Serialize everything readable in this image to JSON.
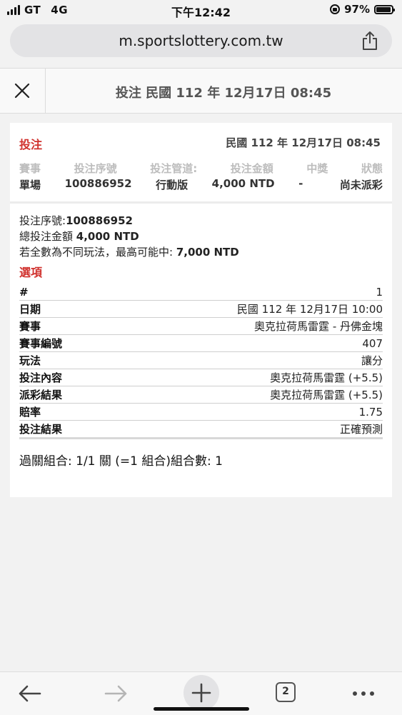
{
  "status_bar": {
    "carrier": "GT",
    "network": "4G",
    "time": "下午12:42",
    "battery": "97%"
  },
  "browser": {
    "url": "m.sportslottery.com.tw",
    "tab_count": "2"
  },
  "header": {
    "title": "投注 民國 112 年 12月17日 08:45"
  },
  "summary": {
    "title": "投注",
    "date": "民國 112 年 12月17日 08:45",
    "columns": [
      "賽事",
      "投注序號",
      "投注管道:",
      "投注金額",
      "中獎",
      "狀態"
    ],
    "values": [
      "單場",
      "100886952",
      "行動版",
      "4,000 NTD",
      "-",
      "尚未派彩"
    ]
  },
  "detail": {
    "serial_label": "投注序號:",
    "serial_value": "100886952",
    "total_label": "總投注金額 ",
    "total_value": "4,000 NTD",
    "max_win_label": "若全數為不同玩法，最高可能中: ",
    "max_win_value": "7,000 NTD"
  },
  "options": {
    "title": "選項",
    "rows": [
      {
        "label": "#",
        "value": "1"
      },
      {
        "label": "日期",
        "value": "民國 112 年 12月17日 10:00"
      },
      {
        "label": "賽事",
        "value": "奧克拉荷馬雷霆 - 丹佛金塊"
      },
      {
        "label": "賽事編號",
        "value": "407"
      },
      {
        "label": "玩法",
        "value": "讓分"
      },
      {
        "label": "投注內容",
        "value": "奧克拉荷馬雷霆 (+5.5)"
      },
      {
        "label": "派彩結果",
        "value": "奧克拉荷馬雷霆 (+5.5)"
      },
      {
        "label": "賠率",
        "value": "1.75"
      },
      {
        "label": "投注結果",
        "value": "正確預測"
      }
    ]
  },
  "combo": {
    "text": "過關組合: 1/1 關 (=1 組合)組合數: 1"
  },
  "colors": {
    "accent_red": "#d0312d",
    "page_bg": "#f2f2f2"
  },
  "icons": [
    "signal-icon",
    "lock-rotation-icon",
    "battery-icon",
    "share-icon",
    "close-icon",
    "back-arrow-icon",
    "forward-arrow-icon",
    "plus-icon",
    "tabs-icon",
    "more-icon"
  ]
}
